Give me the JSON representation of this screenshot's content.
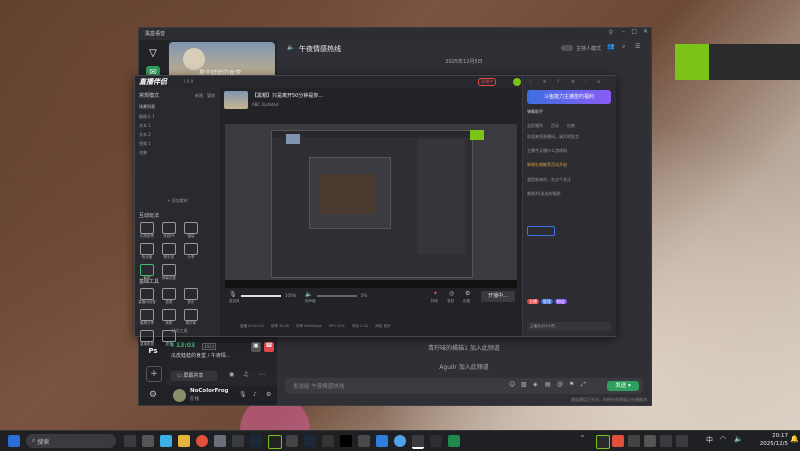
{
  "colors": {
    "accent_green": "#7bc317",
    "chat_bg": "#2d2e33",
    "stream_bg": "#2a2c31",
    "taskbar_bg": "#1f2023",
    "live_red": "#e0484b"
  },
  "chat_app": {
    "title": "黑盒语音",
    "sidebar_icons": [
      "app-logo-icon",
      "chat-icon",
      "photoshop-icon",
      "add-icon",
      "settings-icon"
    ],
    "ps_label": "Ps",
    "group_card_text": "星空蛙蛙的食堂",
    "channel_title": "午夜情感热线",
    "broadcaster_mode_label": "主持人模式",
    "date_divider": "2025年12月5日",
    "system_messages": [
      "青柠味的橘猫1 加入此频道",
      "Aguilr 加入此频道"
    ],
    "input_placeholder": "发送给 午夜情感热线",
    "send_label": "发送",
    "footer_tip": "频道通话已开启，你所在的频道正在被推流",
    "voice_status": {
      "time": "13:03",
      "badge": "1024",
      "channel": "瓜皮蛙蛙的食堂 / 午夜情...",
      "share_label": "屏幕共享"
    },
    "user": {
      "name": "NoColorFrog",
      "status": "在线"
    }
  },
  "stream_app": {
    "title": "直播伴侣",
    "version": "7.9.9",
    "live_badge": "直播中",
    "scene_header": "常规模式",
    "scene_actions": [
      "新建",
      "管理"
    ],
    "scene_tab": "场景列表",
    "sources": [
      "摄像头 1",
      "文本 1",
      "文本 2",
      "视频 1",
      "合集"
    ],
    "add_source": "+ 添加素材",
    "interact_section": "互动玩法",
    "interact_items": [
      "礼物投票",
      "连线PK",
      "福袋",
      "粉丝团",
      "聊天室",
      "分享",
      "截屏",
      "弹幕设置"
    ],
    "tools_section": "基础工具",
    "tools_items": [
      "直播间设置",
      "投屏",
      "音乐",
      "截屏分享",
      "美颜",
      "素材库",
      "直播数据",
      "更多"
    ],
    "more_tools": "一站式工具",
    "broadcast_title": "【黑帽】只是离开50分钟是你...",
    "broadcast_sub": "ABC Updated",
    "center_controls": [
      "麦克风",
      "扬声器"
    ],
    "mic_level": "100%",
    "speaker_level": "0%",
    "bottom_buttons": [
      "特效",
      "录制",
      "设置"
    ],
    "start_button": "开播中...",
    "stats": [
      "直播 00:51:03",
      "帧率 30.00",
      "码率 6000kbps",
      "CPU 12%",
      "内存 2.1G",
      "网络 良好"
    ],
    "right_banner": "斗鱼能力主播签约福利",
    "right_tabs": [
      "全民福利",
      "活动",
      "礼物"
    ],
    "right_header": "弹幕助手",
    "chat_messages": [
      "欢迎来到直播间，请文明发言",
      "主播今天播什么游戏呀",
      "新增礼物推荐活动开启",
      "我是新来的，先点个关注",
      "感谢XX送出的福袋"
    ],
    "chat_badges": [
      "主播",
      "管理",
      "粉丝"
    ],
    "chat_input_placeholder": "主播说点什么吧..."
  },
  "taskbar": {
    "search_placeholder": "搜索",
    "time": "20:17",
    "date": "2025/12/5",
    "tray_lang": "中"
  }
}
